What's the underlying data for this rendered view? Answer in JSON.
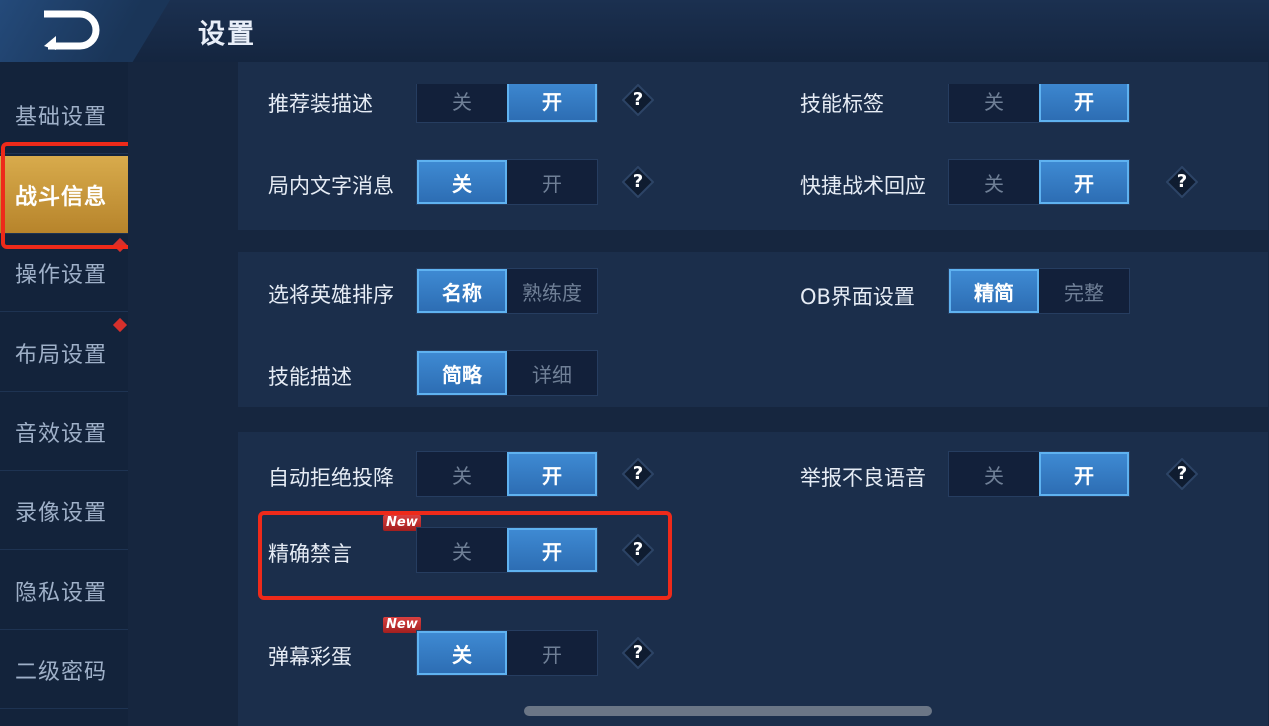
{
  "header": {
    "title": "设置"
  },
  "sidebar": {
    "items": [
      {
        "label": "基础设置"
      },
      {
        "label": "战斗信息"
      },
      {
        "label": "操作设置"
      },
      {
        "label": "布局设置"
      },
      {
        "label": "音效设置"
      },
      {
        "label": "录像设置"
      },
      {
        "label": "隐私设置"
      },
      {
        "label": "二级密码"
      }
    ],
    "active_index": 1
  },
  "settings": {
    "rec_equip": {
      "label": "推荐装描述",
      "off": "关",
      "on": "开",
      "selected": "on",
      "help": "?"
    },
    "skill_tag": {
      "label": "技能标签",
      "off": "关",
      "on": "开",
      "selected": "on"
    },
    "in_game_text": {
      "label": "局内文字消息",
      "off": "关",
      "on": "开",
      "selected": "off",
      "help": "?"
    },
    "quick_tactic": {
      "label": "快捷战术回应",
      "off": "关",
      "on": "开",
      "selected": "on",
      "help": "?"
    },
    "hero_sort": {
      "label": "选将英雄排序",
      "opt1": "名称",
      "opt2": "熟练度",
      "selected": "opt1"
    },
    "ob_ui": {
      "label": "OB界面设置",
      "opt1": "精简",
      "opt2": "完整",
      "selected": "opt1"
    },
    "skill_desc": {
      "label": "技能描述",
      "opt1": "简略",
      "opt2": "详细",
      "selected": "opt1"
    },
    "auto_reject": {
      "label": "自动拒绝投降",
      "off": "关",
      "on": "开",
      "selected": "on",
      "help": "?"
    },
    "report_voice": {
      "label": "举报不良语音",
      "off": "关",
      "on": "开",
      "selected": "on",
      "help": "?"
    },
    "precise_mute": {
      "label": "精确禁言",
      "badge": "New",
      "off": "关",
      "on": "开",
      "selected": "on",
      "help": "?"
    },
    "danmaku_egg": {
      "label": "弹幕彩蛋",
      "badge": "New",
      "off": "关",
      "on": "开",
      "selected": "off",
      "help": "?"
    }
  },
  "colors": {
    "accent": "#3f8bd4",
    "active_tab": "#d8ab4c",
    "highlight": "#ee2a1a"
  }
}
